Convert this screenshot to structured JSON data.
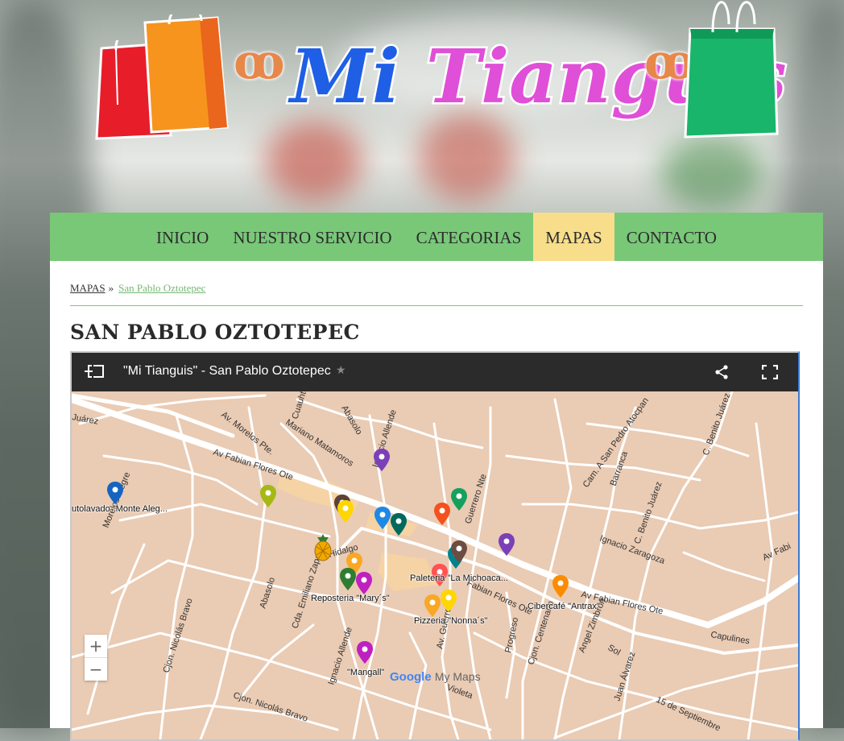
{
  "logo": {
    "word1": "Mi",
    "word2": "Tianguis"
  },
  "nav": {
    "items": [
      {
        "label": "INICIO"
      },
      {
        "label": "NUESTRO SERVICIO"
      },
      {
        "label": "CATEGORIAS"
      },
      {
        "label": "MAPAS"
      },
      {
        "label": "CONTACTO"
      }
    ]
  },
  "breadcrumb": {
    "parent": "MAPAS",
    "separator": "»",
    "current": "San Pablo Oztotepec"
  },
  "page": {
    "title": "SAN PABLO OZTOTEPEC"
  },
  "map": {
    "title": "\"Mi Tianguis\" - San Pablo Oztotepec",
    "star": "★",
    "zoom_in": "+",
    "zoom_out": "−",
    "brand": "Google",
    "product": "My Maps",
    "street_labels": [
      "Av Fabian Flores Ote",
      "Av. Morelos Pte.",
      "Mariano Matamoros",
      "Abasolo",
      "Ignacio Allende",
      "Cuauhtémoc",
      "Cam. A San Pedro Atocpan",
      "C. Benito Juárez",
      "Barranca",
      "Ignacio Zaragoza",
      "C. Benito Juárez",
      "Av Fabian Flores Ote",
      "Capulines",
      "Angel Zimbron",
      "Sol",
      "Juan Álvarez",
      "15 de Septiembre",
      "Violeta",
      "Cjon. Centenario",
      "Progreso",
      "Abasolo",
      "Cjon. Nicolás Bravo",
      "Cjon. Nicolás Bravo",
      "Ignacio Allende",
      "Cda. Emiliano Zapata",
      "Av Hidalgo",
      "Av. Guerrero",
      "Guerrero Nte",
      "Morelos Alegre",
      "Juárez",
      "Fabian Flores Ote",
      "Av Fabi"
    ],
    "place_labels": [
      "utolavado \"Monte Aleg...",
      "Paleteria \"La Michoaca...",
      "Reposteria \"Mary´s\"",
      "Pizzeria \"Nonna´s\"",
      "Cibercafé \"Antrax\"",
      "\"Mangall\""
    ],
    "colors": {
      "blue_dark": "#1565c0",
      "purple": "#7b3fb8",
      "green": "#16a05d",
      "orange": "#f4511e",
      "yellow": "#ffd600",
      "brown": "#6d4c41",
      "teal": "#00838f",
      "olive": "#a5b815",
      "magenta": "#c020c0",
      "amber": "#f9a825",
      "red": "#ff5252",
      "light_blue": "#1e88e5",
      "dark_green": "#2e7d32",
      "orange_light": "#fb8c00"
    }
  }
}
